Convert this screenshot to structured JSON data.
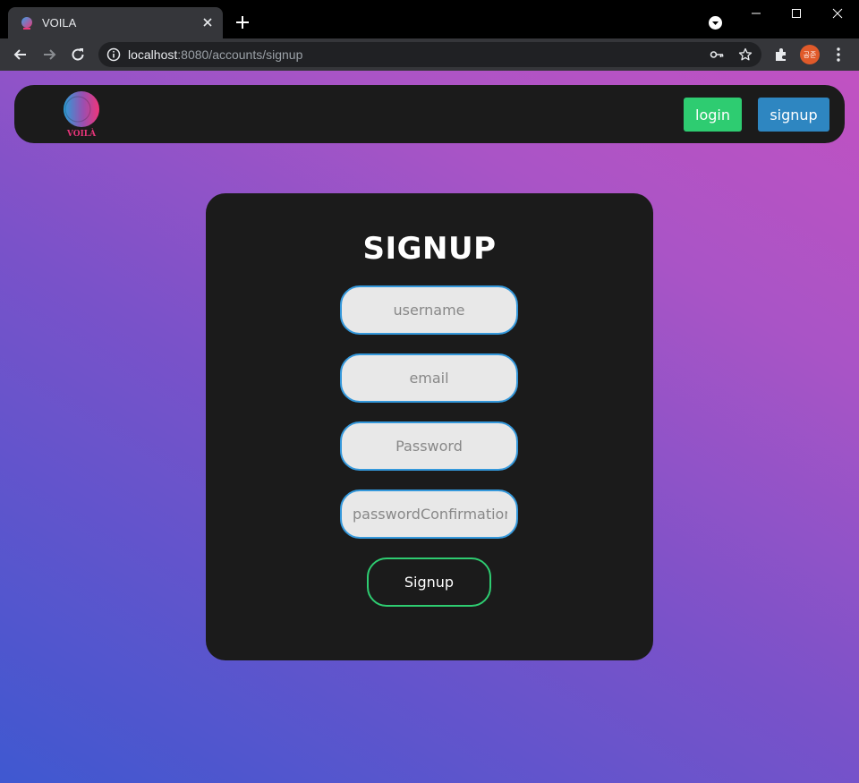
{
  "browser": {
    "tab_title": "VOILA",
    "url_host": "localhost",
    "url_rest": ":8080/accounts/signup",
    "profile_initials": "공준"
  },
  "navbar": {
    "logo_text": "VOILÀ",
    "login_label": "login",
    "signup_label": "signup"
  },
  "form": {
    "title": "SIGNUP",
    "username_placeholder": "username",
    "email_placeholder": "email",
    "password_placeholder": "Password",
    "password_confirmation_placeholder": "passwordConfirmation",
    "submit_label": "Signup"
  },
  "colors": {
    "login_button": "#2ecc71",
    "signup_button": "#2e86c1",
    "input_border": "#3498db",
    "submit_border": "#2ecc71",
    "card_background": "#1b1b1b"
  }
}
